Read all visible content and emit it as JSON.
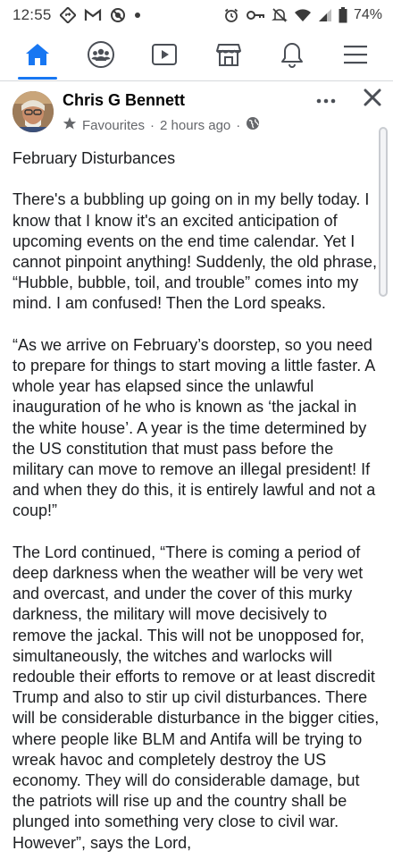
{
  "status_bar": {
    "time": "12:55",
    "battery": "74%",
    "left_icons": [
      "navigation-icon",
      "gmail-icon",
      "no-disturb-icon",
      "dot-icon"
    ],
    "right_icons": [
      "alarm-icon",
      "vpn-key-icon",
      "mute-icon",
      "wifi-icon",
      "signal-icon",
      "battery-icon"
    ]
  },
  "nav": {
    "items": [
      "home-icon",
      "groups-icon",
      "watch-icon",
      "marketplace-icon",
      "notifications-icon",
      "menu-icon"
    ],
    "active": "home-icon",
    "accent_color": "#1877f2"
  },
  "post": {
    "author": "Chris G Bennett",
    "audience": "Favourites",
    "separator": "·",
    "time": "2 hours ago",
    "separator2": "·",
    "paragraphs": [
      "February Disturbances",
      "There's a bubbling up going on in my belly today. I know that I know it's an excited anticipation of upcoming events on the end time calendar. Yet I cannot pinpoint anything! Suddenly, the old phrase, “Hubble, bubble, toil, and trouble” comes into my mind. I am confused! Then the Lord speaks.",
      "“As we arrive on February’s doorstep, so you need to prepare for things to start moving a little faster. A whole year has elapsed since the unlawful inauguration of he who is known as ‘the jackal in the white house’. A year is the time determined by the US constitution that must pass before the military can move to remove an illegal president! If and when they do this, it is entirely lawful and not a coup!”",
      "The Lord continued, “There is coming a period of deep darkness when the weather will be very wet and overcast, and under the cover of this murky darkness, the military will move decisively to remove the jackal. This will not be unopposed for, simultaneously, the witches and warlocks will redouble their efforts to remove or at least discredit Trump and also to stir up civil disturbances. There will be considerable disturbance in the bigger cities, where people like BLM and Antifa will be trying to wreak havoc and completely destroy the US economy. They will do considerable damage, but the patriots will rise up and the country shall be plunged into something very close to civil war. However”, says the Lord,"
    ]
  }
}
